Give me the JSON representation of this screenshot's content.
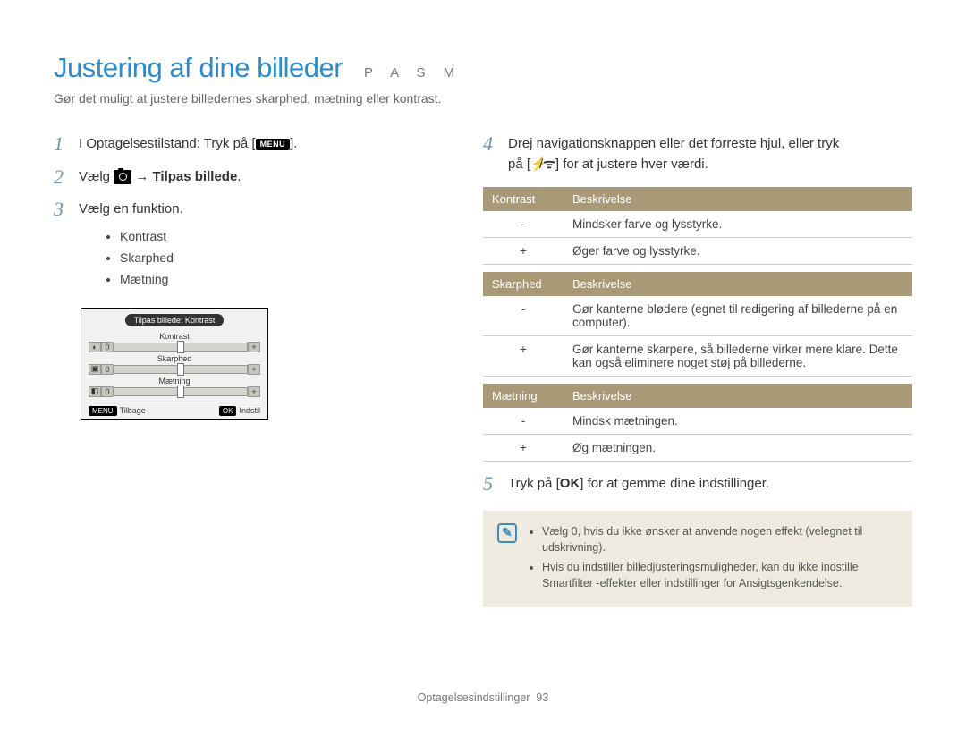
{
  "header": {
    "title": "Justering af dine billeder",
    "modes": "P A S M",
    "subtitle": "Gør det muligt at justere billedernes skarphed, mætning eller kontrast."
  },
  "steps": {
    "s1": {
      "num": "1",
      "pre": "I Optagelsestilstand: Tryk på [",
      "icon": "MENU",
      "post": "]."
    },
    "s2": {
      "num": "2",
      "pre": "Vælg ",
      "arrow": " → ",
      "bold": "Tilpas billede",
      "post": "."
    },
    "s3": {
      "num": "3",
      "text": "Vælg en funktion.",
      "bullets": [
        "Kontrast",
        "Skarphed",
        "Mætning"
      ]
    },
    "s4": {
      "num": "4",
      "line1_pre": "Drej navigationsknappen eller det forreste hjul, eller tryk",
      "line2_pre": "på [",
      "flash": "⚡",
      "slash": "/",
      "wifi": "ᯤ",
      "line2_post": "] for at justere hver værdi."
    },
    "s5": {
      "num": "5",
      "pre": "Tryk på [",
      "ok": "OK",
      "post": "] for at gemme dine indstillinger."
    }
  },
  "lcd": {
    "title": "Tilpas billede: Kontrast",
    "rows": [
      {
        "label": "Kontrast",
        "left_icon": "◐",
        "left_val": "0",
        "right": "+"
      },
      {
        "label": "Skarphed",
        "left_icon": "▣",
        "left_val": "0",
        "right": "+"
      },
      {
        "label": "Mætning",
        "left_icon": "◧",
        "left_val": "0",
        "right": "+"
      }
    ],
    "footer": {
      "back_btn": "MENU",
      "back": "Tilbage",
      "set_btn": "OK",
      "set": "Indstil"
    }
  },
  "tables": {
    "contrast": {
      "h1": "Kontrast",
      "h2": "Beskrivelse",
      "rows": [
        {
          "k": "-",
          "v": "Mindsker farve og lysstyrke."
        },
        {
          "k": "+",
          "v": "Øger farve og lysstyrke."
        }
      ]
    },
    "sharpness": {
      "h1": "Skarphed",
      "h2": "Beskrivelse",
      "rows": [
        {
          "k": "-",
          "v": "Gør kanterne blødere (egnet til redigering af billederne på en computer)."
        },
        {
          "k": "+",
          "v": "Gør kanterne skarpere, så billederne virker mere klare. Dette kan også eliminere noget støj på billederne."
        }
      ]
    },
    "saturation": {
      "h1": "Mætning",
      "h2": "Beskrivelse",
      "rows": [
        {
          "k": "-",
          "v": "Mindsk mætningen."
        },
        {
          "k": "+",
          "v": "Øg mætningen."
        }
      ]
    }
  },
  "note": {
    "items": [
      "Vælg 0, hvis du ikke ønsker at anvende nogen effekt (velegnet til udskrivning).",
      "Hvis du indstiller billedjusteringsmuligheder, kan du ikke indstille Smartfilter -effekter eller indstillinger for Ansigtsgenkendelse."
    ]
  },
  "footer": {
    "section": "Optagelsesindstillinger",
    "page": "93"
  }
}
